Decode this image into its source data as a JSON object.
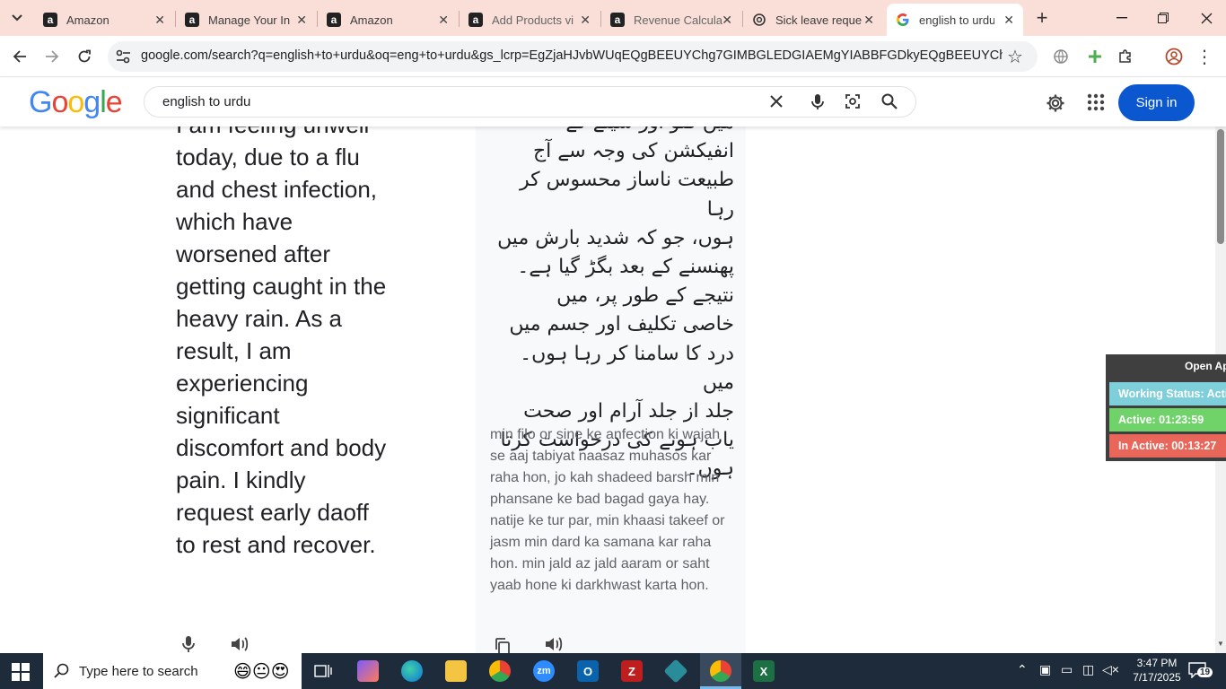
{
  "browser": {
    "tabs": [
      {
        "label": "Amazon",
        "icon": "amazon-icon",
        "active": false
      },
      {
        "label": "Manage Your In",
        "icon": "amazon-icon",
        "active": false
      },
      {
        "label": "Amazon",
        "icon": "amazon-icon",
        "active": false
      },
      {
        "label": "Add Products vi",
        "icon": "amazon-icon",
        "active": false
      },
      {
        "label": "Revenue Calcula",
        "icon": "amazon-icon",
        "active": false
      },
      {
        "label": "Sick leave reque",
        "icon": "chatgpt-icon",
        "active": false
      },
      {
        "label": "english to urdu",
        "icon": "google-icon",
        "active": true
      }
    ],
    "new_tab_symbol": "+",
    "url": "google.com/search?q=english+to+urdu&oq=eng+to+urdu&gs_lcrp=EgZjaHJvbWUqEQgBEEUYChg7GIMBGLEDGIAEMgYIABBFGDkyEQgBEEUYChg7GIM..."
  },
  "google": {
    "logo": "Google",
    "query": "english to urdu",
    "sign_in": "Sign in"
  },
  "translation": {
    "source_lines": [
      "I am feeling unwell",
      "today, due to a flu",
      "and chest infection,",
      "which have",
      "worsened after",
      "getting caught in the",
      "heavy rain. As a",
      "result, I am",
      "experiencing",
      "significant",
      "discomfort and body",
      "pain. I kindly",
      "request early daoff",
      "to rest and recover."
    ],
    "urdu_lines": [
      "میں فلو اور سینے کے",
      "انفیکشن کی وجہ سے آج",
      "طبیعت ناساز محسوس کر رہا",
      "ہوں، جو کہ شدید بارش میں",
      "پھنسنے کے بعد بگڑ گیا ہے۔",
      "نتیجے کے طور پر، میں",
      "خاصی تکلیف اور جسم میں",
      "درد کا سامنا کر رہا ہوں۔ میں",
      "جلد از جلد آرام اور صحت",
      "یاب ہونے کی درخواست کرتا",
      "ہوں۔"
    ],
    "transliteration_lines": [
      "min filo or sine ke anfection ki wajah",
      "se aaj tabiyat naasaz muhasos kar",
      "raha hon, jo kah shadeed barsh min",
      "phansane ke bad bagad gaya hay.",
      "natije ke tur par, min khaasi takeef or",
      "jasm min dard ka samana kar raha",
      "hon. min jald az jald aaram or saht",
      "yaab hone ki darkhwast karta hon."
    ]
  },
  "widget": {
    "open_label": "Open Ap",
    "working_status": "Working Status: Active",
    "active": "Active: 01:23:59",
    "inactive": "In Active: 00:13:27",
    "colors": {
      "status": "#7ecfd9",
      "active": "#6fd36a",
      "inactive": "#e8675a"
    }
  },
  "taskbar": {
    "search_placeholder": "Type here to search",
    "time": "3:47 PM",
    "date": "7/17/2025",
    "notification_count": "19"
  }
}
